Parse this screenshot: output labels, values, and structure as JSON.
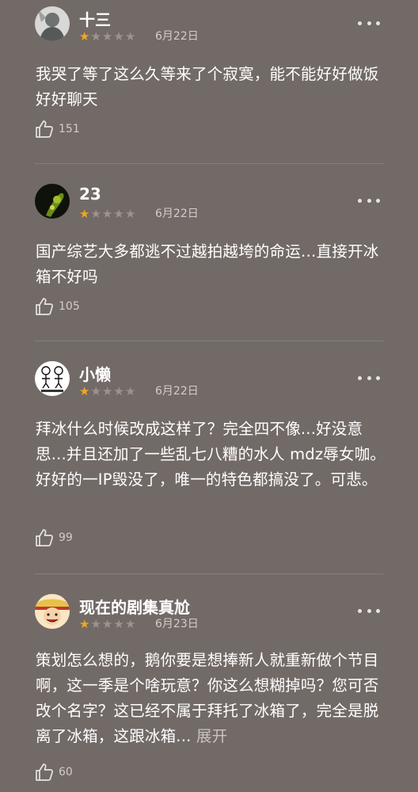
{
  "reviews": [
    {
      "username": "十三",
      "rating": 1,
      "date": "6月22日",
      "content": "我哭了等了这么久等来了个寂寞，能不能好好做饭好好聊天",
      "expand_label": "",
      "likes": "151",
      "avatar_icon": "grey-figure-avatar"
    },
    {
      "username": "23",
      "rating": 1,
      "date": "6月22日",
      "content": "国产综艺大多都逃不过越拍越垮的命运…直接开冰箱不好吗",
      "expand_label": "",
      "likes": "105",
      "avatar_icon": "dark-green-avatar"
    },
    {
      "username": "小懒",
      "rating": 1,
      "date": "6月22日",
      "content": "拜冰什么时候改成这样了？完全四不像...好没意思...并且还加了一些乱七八糟的水人 mdz辱女咖。好好的一IP毁没了，唯一的特色都搞没了。可悲。",
      "expand_label": "",
      "likes": "99",
      "avatar_icon": "sketch-figures-avatar"
    },
    {
      "username": "现在的剧集真尬",
      "rating": 1,
      "date": "6月23日",
      "content": "策划怎么想的，鹅你要是想捧新人就重新做个节目啊，这一季是个啥玩意？你这么想糊掉吗？您可否改个名字？这已经不属于拜托了冰箱了，完全是脱离了冰箱，这跟冰箱...",
      "expand_label": "展开",
      "likes": "60",
      "avatar_icon": "cartoon-pirate-avatar"
    }
  ],
  "colors": {
    "background": "#726a67",
    "star_filled": "#f0a81e",
    "star_empty": "#9a9390"
  }
}
